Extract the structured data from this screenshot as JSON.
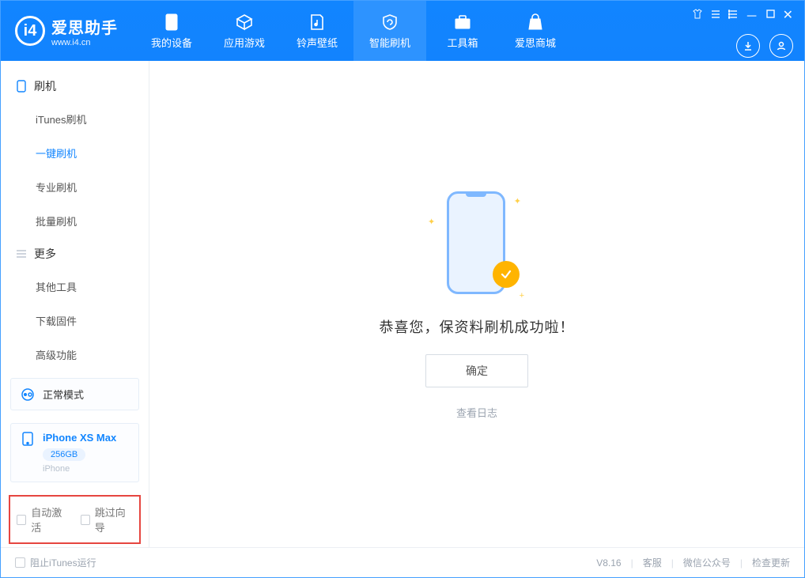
{
  "app": {
    "name_cn": "爱思助手",
    "name_en": "www.i4.cn"
  },
  "nav": [
    {
      "label": "我的设备"
    },
    {
      "label": "应用游戏"
    },
    {
      "label": "铃声壁纸"
    },
    {
      "label": "智能刷机"
    },
    {
      "label": "工具箱"
    },
    {
      "label": "爱思商城"
    }
  ],
  "sidebar": {
    "section1": {
      "title": "刷机",
      "items": [
        "iTunes刷机",
        "一键刷机",
        "专业刷机",
        "批量刷机"
      ]
    },
    "section2": {
      "title": "更多",
      "items": [
        "其他工具",
        "下载固件",
        "高级功能"
      ]
    },
    "mode_label": "正常模式",
    "device": {
      "name": "iPhone XS Max",
      "capacity": "256GB",
      "type": "iPhone"
    },
    "checks": {
      "auto_activate": "自动激活",
      "skip_guide": "跳过向导"
    }
  },
  "main": {
    "success_msg": "恭喜您，保资料刷机成功啦！",
    "ok_label": "确定",
    "log_link": "查看日志"
  },
  "footer": {
    "block_itunes": "阻止iTunes运行",
    "version": "V8.16",
    "links": [
      "客服",
      "微信公众号",
      "检查更新"
    ]
  }
}
